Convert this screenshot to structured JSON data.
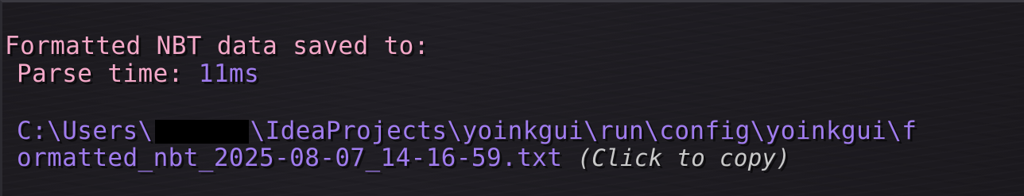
{
  "message": {
    "title": "Formatted NBT data saved to:",
    "parse_label": "Parse time:",
    "parse_value": "11ms",
    "path_prefix": "C:\\Users\\",
    "path_suffix": "\\IdeaProjects\\yoinkgui\\run\\config\\yoinkgui\\f",
    "path_line2": "ormatted_nbt_2025-08-07_14-16-59.txt",
    "copy_hint": "(Click to copy)"
  },
  "colors": {
    "pink": "#f4a8c8",
    "purple": "#a07cee",
    "hint_gray": "#c9c9c9",
    "background": "#1d1b20"
  }
}
